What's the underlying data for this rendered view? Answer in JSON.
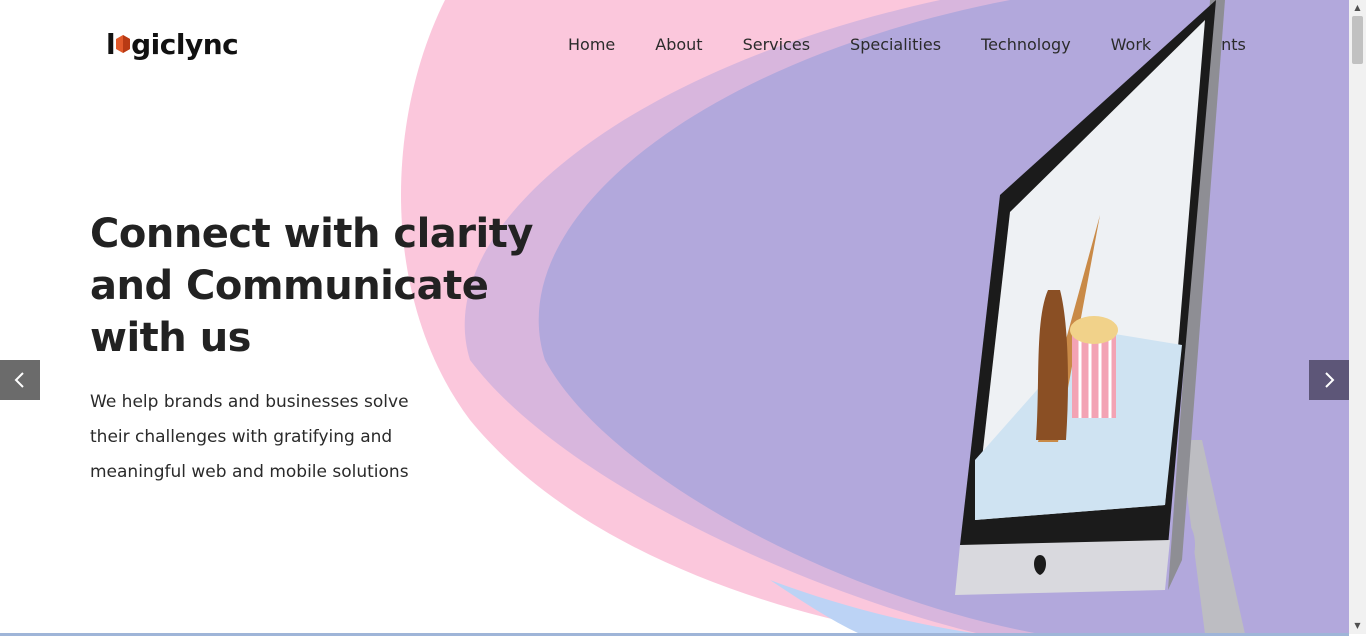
{
  "brand": {
    "logo_prefix": "l",
    "logo_suffix": "giclync"
  },
  "nav": {
    "items": [
      "Home",
      "About",
      "Services",
      "Specialities",
      "Technology",
      "Work",
      "Clients"
    ]
  },
  "hero": {
    "title": "Connect with clarity and Communicate with us",
    "subtitle": "We help brands and businesses solve their challenges with gratifying and meaningful web and mobile solutions"
  },
  "carousel": {
    "prev_icon": "chevron-left-icon",
    "next_icon": "chevron-right-icon"
  },
  "colors": {
    "pink": "#fbc7dc",
    "lavender": "#b2a8dc",
    "accent": "#e25a2b",
    "text_dark": "#222222"
  },
  "scrollbar": {
    "up_glyph": "▲",
    "down_glyph": "▼"
  }
}
